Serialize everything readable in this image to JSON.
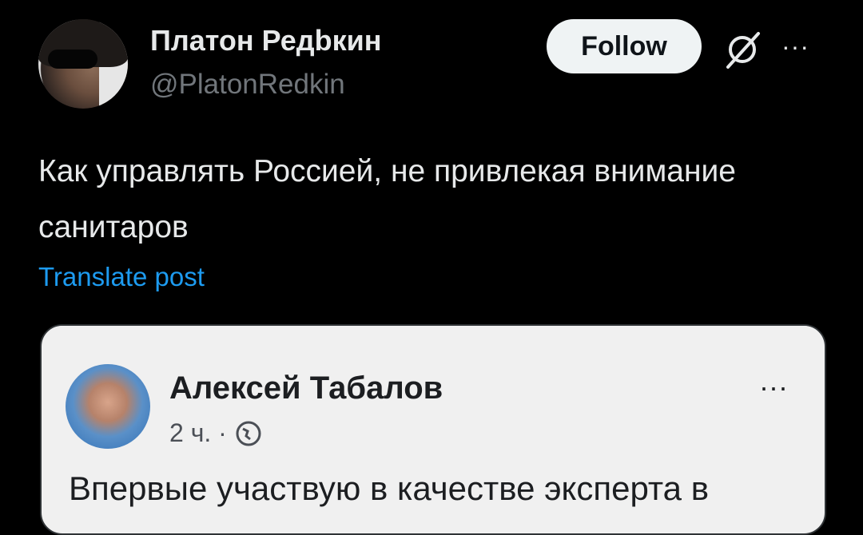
{
  "tweet": {
    "author_name": "Платон Редbкин",
    "author_handle": "@PlatonRedkin",
    "follow_label": "Follow",
    "more_label": "···",
    "text": "Как управлять Россией, не привлекая внимание санитаров",
    "translate_label": "Translate post"
  },
  "embedded_post": {
    "author_name": "Алексей Табалов",
    "time": "2 ч. ·",
    "more_label": "···",
    "text": "Впервые участвую в качестве эксперта в"
  },
  "icons": {
    "grok": "grok-icon",
    "more": "more-horizontal-icon",
    "globe": "globe-icon"
  },
  "colors": {
    "background": "#000000",
    "link": "#1d9bf0",
    "follow_bg": "#eff3f4",
    "secondary_text": "#71767b"
  }
}
